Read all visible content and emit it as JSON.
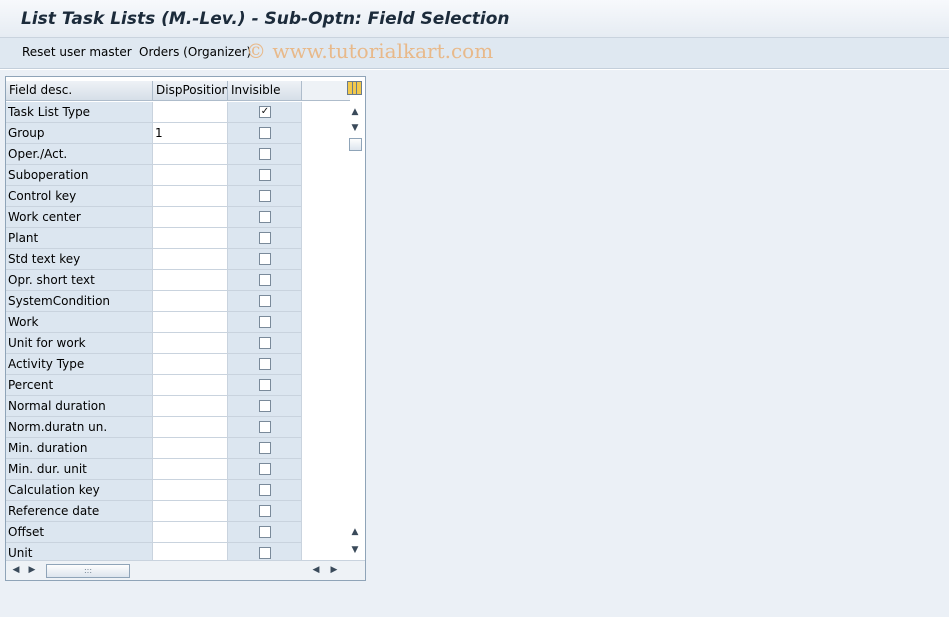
{
  "window": {
    "title": "List Task Lists (M.-Lev.) - Sub-Optn: Field Selection"
  },
  "toolbar": {
    "reset_label": "Reset user master",
    "orders_label": "Orders (Organizer)",
    "watermark": "© www.tutorialkart.com"
  },
  "table": {
    "headers": {
      "field_desc": "Field desc.",
      "disp_position": "DispPosition",
      "invisible": "Invisible"
    },
    "check_mark": "✓",
    "rows": [
      {
        "desc": "Task List Type",
        "pos": "",
        "invisible": true
      },
      {
        "desc": "Group",
        "pos": "1",
        "invisible": false
      },
      {
        "desc": "Oper./Act.",
        "pos": "",
        "invisible": false
      },
      {
        "desc": "Suboperation",
        "pos": "",
        "invisible": false
      },
      {
        "desc": "Control key",
        "pos": "",
        "invisible": false
      },
      {
        "desc": "Work center",
        "pos": "",
        "invisible": false
      },
      {
        "desc": "Plant",
        "pos": "",
        "invisible": false
      },
      {
        "desc": "Std text key",
        "pos": "",
        "invisible": false
      },
      {
        "desc": "Opr. short text",
        "pos": "",
        "invisible": false
      },
      {
        "desc": "SystemCondition",
        "pos": "",
        "invisible": false
      },
      {
        "desc": "Work",
        "pos": "",
        "invisible": false
      },
      {
        "desc": "Unit for work",
        "pos": "",
        "invisible": false
      },
      {
        "desc": "Activity Type",
        "pos": "",
        "invisible": false
      },
      {
        "desc": "Percent",
        "pos": "",
        "invisible": false
      },
      {
        "desc": "Normal duration",
        "pos": "",
        "invisible": false
      },
      {
        "desc": "Norm.duratn un.",
        "pos": "",
        "invisible": false
      },
      {
        "desc": "Min. duration",
        "pos": "",
        "invisible": false
      },
      {
        "desc": "Min. dur. unit",
        "pos": "",
        "invisible": false
      },
      {
        "desc": "Calculation key",
        "pos": "",
        "invisible": false
      },
      {
        "desc": "Reference date",
        "pos": "",
        "invisible": false
      },
      {
        "desc": "Offset",
        "pos": "",
        "invisible": false
      },
      {
        "desc": "Unit",
        "pos": "",
        "invisible": false
      }
    ]
  },
  "icons": {
    "settings": "table-settings-icon",
    "scroll_up": "▲",
    "scroll_down": "▼",
    "scroll_left": "◀",
    "scroll_right": "▶",
    "grip": ":::"
  }
}
